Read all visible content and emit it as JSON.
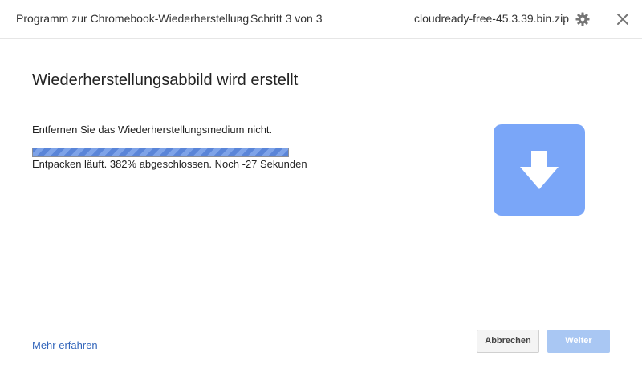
{
  "header": {
    "app_title": "Programm zur Chromebook-Wiederherstellung",
    "breadcrumb_separator": "›",
    "step_label": "Schritt 3 von 3",
    "file_name": "cloudready-free-45.3.39.bin.zip",
    "settings_icon": "gear-icon",
    "close_icon": "close-icon"
  },
  "main": {
    "title": "Wiederherstellungsabbild wird erstellt",
    "instruction": "Entfernen Sie das Wiederherstellungsmedium nicht.",
    "progress_fraction": 1.0,
    "progress_status": "Entpacken läuft. 382% abgeschlossen. Noch -27 Sekunden",
    "illustration_icon": "download-arrow-icon"
  },
  "footer": {
    "learn_more_label": "Mehr erfahren",
    "cancel_label": "Abbrechen",
    "next_label": "Weiter"
  },
  "colors": {
    "accent": "#7aa6f8",
    "link": "#3366bb",
    "progress": "#5a85d8",
    "next_button_disabled": "#a9c7f3"
  }
}
